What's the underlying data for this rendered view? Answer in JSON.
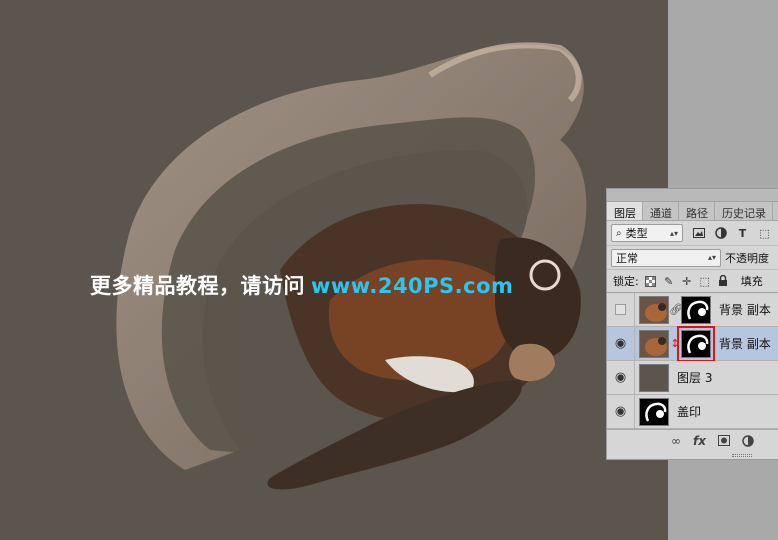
{
  "watermark": {
    "chinese": "更多精品教程，请访问",
    "url": "www.240PS.com"
  },
  "panel": {
    "tabs": [
      "图层",
      "通道",
      "路径",
      "历史记录"
    ],
    "active_tab": "图层",
    "filter": {
      "label": "类型",
      "icon": "search-icon"
    },
    "blend_mode": "正常",
    "opacity_label": "不透明度",
    "lock_label": "锁定:",
    "fill_label": "填充",
    "layers": [
      {
        "name": "背景 副本",
        "visible": false,
        "selected": false
      },
      {
        "name": "背景 副本",
        "visible": true,
        "selected": true
      },
      {
        "name": "图层 3",
        "visible": true,
        "selected": false
      },
      {
        "name": "盖印",
        "visible": true,
        "selected": false
      }
    ]
  },
  "colors": {
    "canvas": "#5b554d",
    "selected_layer": "#b6c6de",
    "watermark_url": "#28c6f0",
    "highlight": "#e01212"
  }
}
